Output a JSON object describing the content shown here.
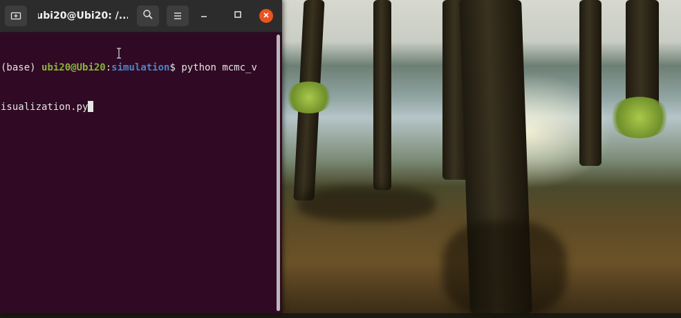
{
  "window": {
    "title": "ubi20@Ubi20: /..."
  },
  "titlebar": {
    "new_tab_icon": "new-tab-icon",
    "search_icon": "search-icon",
    "menu_icon": "hamburger-menu-icon",
    "minimize_glyph": "–",
    "maximize_glyph": "☐",
    "close_glyph": "✕"
  },
  "terminal": {
    "env": "(base) ",
    "user_host": "ubi20@Ubi20",
    "colon": ":",
    "cwd": "simulation",
    "prompt_symbol": "$ ",
    "command_line1": "python mcmc_v",
    "command_line2": "isualization.py",
    "colors": {
      "background": "#300a24",
      "user": "#87b53a",
      "path": "#4b84c9",
      "text": "#e5e5e5"
    }
  }
}
